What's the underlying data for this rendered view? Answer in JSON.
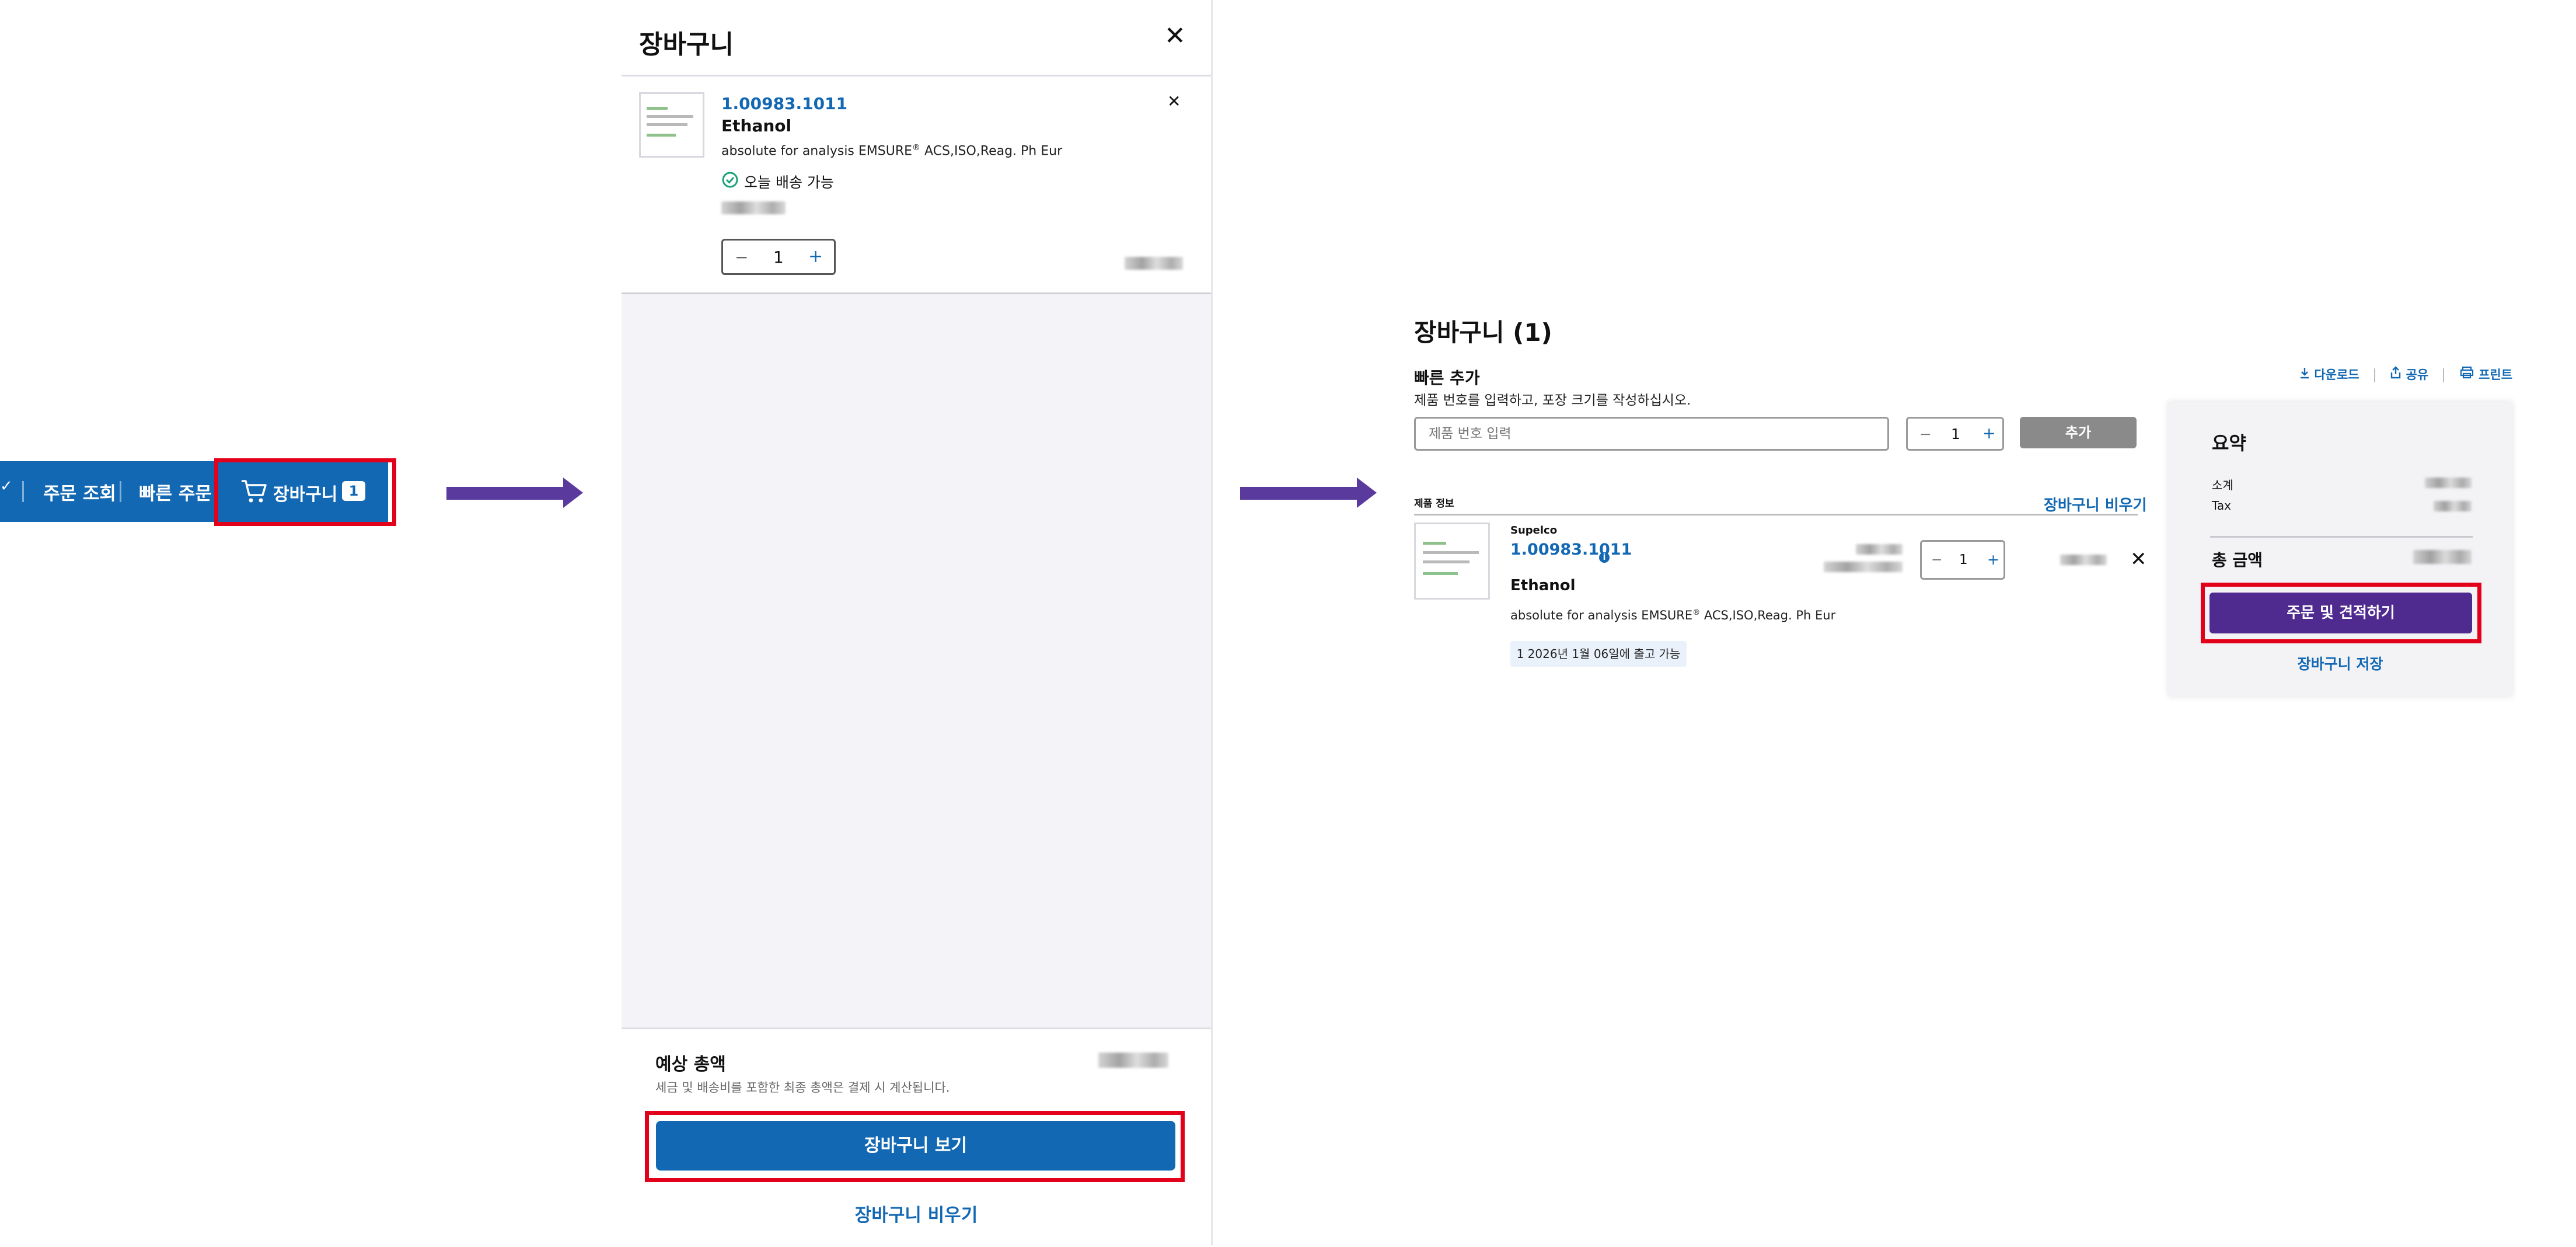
{
  "nav": {
    "chevron_glyph": "✓",
    "order_lookup": "주문 조회",
    "quick_order": "빠른 주문",
    "cart_label": "장바구니",
    "cart_count": "1"
  },
  "mini_cart": {
    "title": "장바구니",
    "close_glyph": "✕",
    "item": {
      "sku": "1.00983.1011",
      "name": "Ethanol",
      "description_prefix": "absolute for analysis EMSURE",
      "description_sup": "®",
      "description_suffix": " ACS,ISO,Reag. Ph Eur",
      "availability": "오늘 배송 가능",
      "remove_glyph": "✕",
      "quantity": "1",
      "minus": "−",
      "plus": "+"
    },
    "estimated_total_label": "예상 총액",
    "estimated_total_note": "세금 및 배송비를 포함한 최종 총액은 결제 시 계산됩니다.",
    "view_cart_button": "장바구니 보기",
    "clear_cart_link": "장바구니 비우기"
  },
  "cart_page": {
    "title": "장바구니 (1)",
    "quick_add_title": "빠른 추가",
    "quick_add_hint": "제품 번호를 입력하고, 포장 크기를 작성하십시오.",
    "sku_placeholder": "제품 번호 입력",
    "quantity": "1",
    "minus": "−",
    "plus": "+",
    "add_button": "추가",
    "actions": {
      "download": "다운로드",
      "share": "공유",
      "print": "프린트"
    },
    "product_info_header": "제품 정보",
    "clear_cart_link": "장바구니 비우기",
    "item": {
      "brand": "Supelco",
      "sku": "1.00983.1011",
      "info_glyph": "i",
      "name": "Ethanol",
      "description_prefix": "absolute for analysis EMSURE",
      "description_sup": "®",
      "description_suffix": " ACS,ISO,Reag. Ph Eur",
      "ship_tag": "1 2026년 1월 06일에 출고 가능",
      "remove_glyph": "✕"
    },
    "summary": {
      "title": "요약",
      "subtotal_label": "소계",
      "tax_label": "Tax",
      "total_label": "총 금액",
      "checkout_button": "주문 및 견적하기",
      "save_cart_link": "장바구니 저장"
    }
  },
  "colors": {
    "brand_blue": "#1268b3",
    "arrow_purple": "#5b3a9e",
    "highlight_red": "#e3001b",
    "checkout_purple": "#4f2a8f"
  }
}
